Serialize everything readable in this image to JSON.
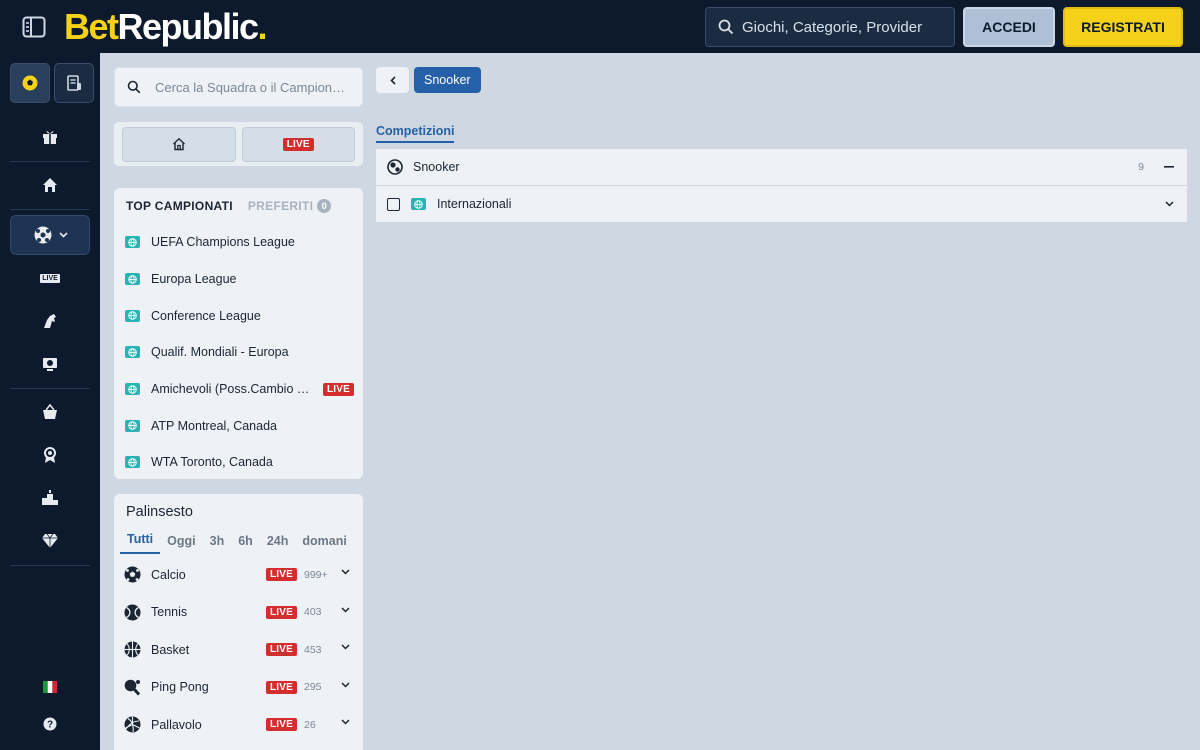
{
  "header": {
    "logo": {
      "part1": "Bet",
      "part2": "Republic",
      "dot": "."
    },
    "search_placeholder": "Giochi, Categorie, Provider",
    "login_label": "ACCEDI",
    "register_label": "REGISTRATI"
  },
  "rail": {
    "tabs": [
      {
        "icon": "sports-ball-icon"
      },
      {
        "icon": "betslip-icon"
      }
    ],
    "items": [
      {
        "icon": "gift-icon"
      },
      {
        "icon": "home-icon"
      },
      {
        "icon": "sports-icon"
      },
      {
        "icon": "live-icon",
        "label": "LIVE"
      },
      {
        "icon": "horse-icon"
      },
      {
        "icon": "virtual-icon"
      },
      {
        "icon": "shop-icon"
      },
      {
        "icon": "award-icon"
      },
      {
        "icon": "podium-icon"
      },
      {
        "icon": "diamond-icon"
      }
    ],
    "bottom": [
      {
        "icon": "italy-flag-icon"
      },
      {
        "icon": "help-icon"
      }
    ]
  },
  "sidebar": {
    "search_placeholder": "Cerca la Squadra o il Campionato",
    "toggle": {
      "live_label": "LIVE"
    },
    "top": {
      "title": "TOP CAMPIONATI",
      "favorites_label": "PREFERITI",
      "favorites_count": "0",
      "leagues": [
        {
          "name": "UEFA Champions League"
        },
        {
          "name": "Europa League"
        },
        {
          "name": "Conference League"
        },
        {
          "name": "Qualif. Mondiali - Europa"
        },
        {
          "name": "Amichevoli (Poss.Cambio Formazione)",
          "live": "LIVE"
        },
        {
          "name": "ATP Montreal, Canada"
        },
        {
          "name": "WTA Toronto, Canada"
        }
      ]
    },
    "palinsesto": {
      "title": "Palinsesto",
      "tabs": [
        "Tutti",
        "Oggi",
        "3h",
        "6h",
        "24h",
        "domani"
      ],
      "sports": [
        {
          "name": "Calcio",
          "live": "LIVE",
          "count": "999+"
        },
        {
          "name": "Tennis",
          "live": "LIVE",
          "count": "403"
        },
        {
          "name": "Basket",
          "live": "LIVE",
          "count": "453"
        },
        {
          "name": "Ping Pong",
          "live": "LIVE",
          "count": "295"
        },
        {
          "name": "Pallavolo",
          "live": "LIVE",
          "count": "26"
        }
      ]
    }
  },
  "main": {
    "breadcrumb": "Snooker",
    "tab": "Competizioni",
    "sport_row": {
      "name": "Snooker",
      "count": "9"
    },
    "competitions": [
      {
        "name": "Internazionali"
      }
    ]
  },
  "colors": {
    "brand_yellow": "#f5d219",
    "navy": "#0d1a2d",
    "accent_blue": "#2560a8",
    "live_red": "#d42d2d"
  }
}
